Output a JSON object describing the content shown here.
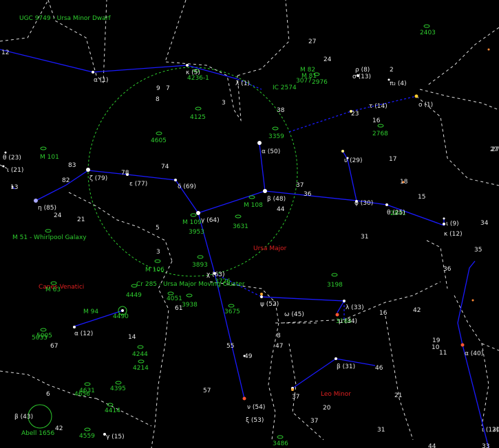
{
  "colors": {
    "background": "#000000",
    "constellation_line": "#1a1aff",
    "boundary": "#e0e0e0",
    "dso": "#2ecc2e",
    "constellation_name": "#e02020"
  },
  "labels": {
    "ugc9749": "UGC 9749 - Ursa Minor Dwarf",
    "ursa_major": "Ursa Major",
    "canes_venatici": "Canes Venatici",
    "leo_minor": "Leo Minor",
    "cr285": "Cr 285 - Ursa Major Moving Cluster",
    "m51": "M 51 - Whirlpool Galaxy",
    "abell1656": "Abell 1656"
  },
  "dso": [
    {
      "id": "2403",
      "label": "2403"
    },
    {
      "id": "m82",
      "label": "M 82"
    },
    {
      "id": "m81",
      "label": "M 81"
    },
    {
      "id": "3077",
      "label": "3077"
    },
    {
      "id": "2976",
      "label": "2976"
    },
    {
      "id": "ic2574",
      "label": "IC 2574"
    },
    {
      "id": "4236",
      "label": "4236-1"
    },
    {
      "id": "4125",
      "label": "4125"
    },
    {
      "id": "4605",
      "label": "4605"
    },
    {
      "id": "3359",
      "label": "3359"
    },
    {
      "id": "2768",
      "label": "2768"
    },
    {
      "id": "m101",
      "label": "M 101"
    },
    {
      "id": "m108",
      "label": "M 108"
    },
    {
      "id": "m109",
      "label": "M 109"
    },
    {
      "id": "3953",
      "label": "3953"
    },
    {
      "id": "3631",
      "label": "3631"
    },
    {
      "id": "2841",
      "label": "2841"
    },
    {
      "id": "3893",
      "label": "3893"
    },
    {
      "id": "3726",
      "label": "3726"
    },
    {
      "id": "m106",
      "label": "M 106"
    },
    {
      "id": "m63",
      "label": "M 63"
    },
    {
      "id": "4449",
      "label": "4449"
    },
    {
      "id": "4051",
      "label": "4051"
    },
    {
      "id": "3938",
      "label": "3938"
    },
    {
      "id": "3675",
      "label": "3675"
    },
    {
      "id": "3198",
      "label": "3198"
    },
    {
      "id": "3184",
      "label": "3184"
    },
    {
      "id": "m94",
      "label": "M 94"
    },
    {
      "id": "4490",
      "label": "4490"
    },
    {
      "id": "5005",
      "label": "5005"
    },
    {
      "id": "5033",
      "label": "5033"
    },
    {
      "id": "4244",
      "label": "4244"
    },
    {
      "id": "4214",
      "label": "4214"
    },
    {
      "id": "4395",
      "label": "4395"
    },
    {
      "id": "4631",
      "label": "4631"
    },
    {
      "id": "4656",
      "label": "4656"
    },
    {
      "id": "4414",
      "label": "4414"
    },
    {
      "id": "4559",
      "label": "4559"
    },
    {
      "id": "3486",
      "label": "3486"
    }
  ],
  "stars": [
    {
      "id": "alpha_umi",
      "label": "α (1)"
    },
    {
      "id": "kappa5",
      "label": "κ (5)"
    },
    {
      "id": "lambda1",
      "label": "λ (1)"
    },
    {
      "id": "rho8",
      "label": "ρ (8)"
    },
    {
      "id": "sigma13",
      "label": "σ (13)"
    },
    {
      "id": "pi2",
      "label": "π₂ (4)"
    },
    {
      "id": "tau14",
      "label": "τ (14)"
    },
    {
      "id": "omicron1",
      "label": "ο (1)"
    },
    {
      "id": "alpha50",
      "label": "α (50)"
    },
    {
      "id": "upsilon29",
      "label": "υ (29)"
    },
    {
      "id": "beta48",
      "label": "β (48)"
    },
    {
      "id": "phi30",
      "label": "φ (30)"
    },
    {
      "id": "theta25",
      "label": "θ (25)"
    },
    {
      "id": "iota9",
      "label": "ι (9)"
    },
    {
      "id": "kappa12",
      "label": "κ (12)"
    },
    {
      "id": "zeta79",
      "label": "ζ (79)"
    },
    {
      "id": "epsilon77",
      "label": "ε (77)"
    },
    {
      "id": "delta69",
      "label": "δ (69)"
    },
    {
      "id": "gamma64",
      "label": "γ (64)"
    },
    {
      "id": "eta85",
      "label": "η (85)"
    },
    {
      "id": "theta23",
      "label": "θ (23)"
    },
    {
      "id": "iota21",
      "label": "ι (21)"
    },
    {
      "id": "chi63",
      "label": "χ (63)"
    },
    {
      "id": "psi52",
      "label": "ψ (52)"
    },
    {
      "id": "omega45",
      "label": "ω (45)"
    },
    {
      "id": "lambda33",
      "label": "λ (33)"
    },
    {
      "id": "mu34",
      "label": "μ (34)"
    },
    {
      "id": "beta31",
      "label": "β (31)"
    },
    {
      "id": "alpha40",
      "label": "α (40)"
    },
    {
      "id": "nu54",
      "label": "ν (54)"
    },
    {
      "id": "xi53",
      "label": "ξ (53)"
    },
    {
      "id": "beta43",
      "label": "β (43)"
    },
    {
      "id": "gamma15",
      "label": "γ (15)"
    },
    {
      "id": "alpha12",
      "label": "α (12)"
    },
    {
      "id": "iota12",
      "label": "ι (12)"
    }
  ],
  "numbers": [
    "12",
    "27",
    "24",
    "2",
    "9",
    "7",
    "8",
    "3",
    "38",
    "23",
    "16",
    "17",
    "18",
    "15",
    "34",
    "27",
    "83",
    "78",
    "74",
    "82",
    "13",
    "24",
    "21",
    "5",
    "3",
    "37",
    "36",
    "44",
    "31",
    "35",
    "36",
    "42",
    "16",
    "19",
    "10",
    "11",
    "8",
    "47",
    "49",
    "55",
    "57",
    "61",
    "67",
    "14",
    "6",
    "37",
    "46",
    "21",
    "20",
    "37",
    "42",
    "31",
    "44",
    "33",
    "30",
    "27"
  ]
}
